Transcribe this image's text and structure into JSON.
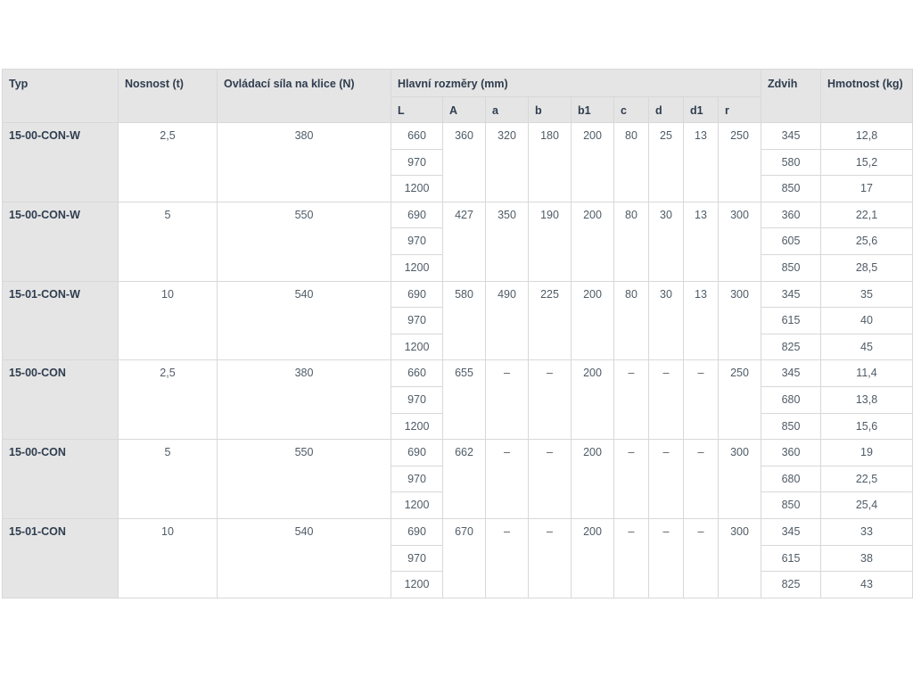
{
  "table": {
    "headers": {
      "typ": "Typ",
      "nosnost": "Nosnost (t)",
      "sila": "Ovládací síla na klice (N)",
      "rozmery": "Hlavní rozměry (mm)",
      "zdvih": "Zdvih",
      "hmotnost": "Hmotnost (kg)",
      "sub": [
        "L",
        "A",
        "a",
        "b",
        "b1",
        "c",
        "d",
        "d1",
        "r"
      ]
    },
    "rows": [
      {
        "typ": "15-00-CON-W",
        "nosnost": "2,5",
        "sila": "380",
        "A": "360",
        "a": "320",
        "b": "180",
        "b1": "200",
        "c": "80",
        "d": "25",
        "d1": "13",
        "r": "250",
        "variants": [
          {
            "L": "660",
            "zdvih": "345",
            "hmotnost": "12,8"
          },
          {
            "L": "970",
            "zdvih": "580",
            "hmotnost": "15,2"
          },
          {
            "L": "1200",
            "zdvih": "850",
            "hmotnost": "17"
          }
        ]
      },
      {
        "typ": "15-00-CON-W",
        "nosnost": "5",
        "sila": "550",
        "A": "427",
        "a": "350",
        "b": "190",
        "b1": "200",
        "c": "80",
        "d": "30",
        "d1": "13",
        "r": "300",
        "variants": [
          {
            "L": "690",
            "zdvih": "360",
            "hmotnost": "22,1"
          },
          {
            "L": "970",
            "zdvih": "605",
            "hmotnost": "25,6"
          },
          {
            "L": "1200",
            "zdvih": "850",
            "hmotnost": "28,5"
          }
        ]
      },
      {
        "typ": "15-01-CON-W",
        "nosnost": "10",
        "sila": "540",
        "A": "580",
        "a": "490",
        "b": "225",
        "b1": "200",
        "c": "80",
        "d": "30",
        "d1": "13",
        "r": "300",
        "variants": [
          {
            "L": "690",
            "zdvih": "345",
            "hmotnost": "35"
          },
          {
            "L": "970",
            "zdvih": "615",
            "hmotnost": "40"
          },
          {
            "L": "1200",
            "zdvih": "825",
            "hmotnost": "45"
          }
        ]
      },
      {
        "typ": "15-00-CON",
        "nosnost": "2,5",
        "sila": "380",
        "A": "655",
        "a": "–",
        "b": "–",
        "b1": "200",
        "c": "–",
        "d": "–",
        "d1": "–",
        "r": "250",
        "variants": [
          {
            "L": "660",
            "zdvih": "345",
            "hmotnost": "11,4"
          },
          {
            "L": "970",
            "zdvih": "680",
            "hmotnost": "13,8"
          },
          {
            "L": "1200",
            "zdvih": "850",
            "hmotnost": "15,6"
          }
        ]
      },
      {
        "typ": "15-00-CON",
        "nosnost": "5",
        "sila": "550",
        "A": "662",
        "a": "–",
        "b": "–",
        "b1": "200",
        "c": "–",
        "d": "–",
        "d1": "–",
        "r": "300",
        "variants": [
          {
            "L": "690",
            "zdvih": "360",
            "hmotnost": "19"
          },
          {
            "L": "970",
            "zdvih": "680",
            "hmotnost": "22,5"
          },
          {
            "L": "1200",
            "zdvih": "850",
            "hmotnost": "25,4"
          }
        ]
      },
      {
        "typ": "15-01-CON",
        "nosnost": "10",
        "sila": "540",
        "A": "670",
        "a": "–",
        "b": "–",
        "b1": "200",
        "c": "–",
        "d": "–",
        "d1": "–",
        "r": "300",
        "variants": [
          {
            "L": "690",
            "zdvih": "345",
            "hmotnost": "33"
          },
          {
            "L": "970",
            "zdvih": "615",
            "hmotnost": "38"
          },
          {
            "L": "1200",
            "zdvih": "825",
            "hmotnost": "43"
          }
        ]
      }
    ]
  }
}
